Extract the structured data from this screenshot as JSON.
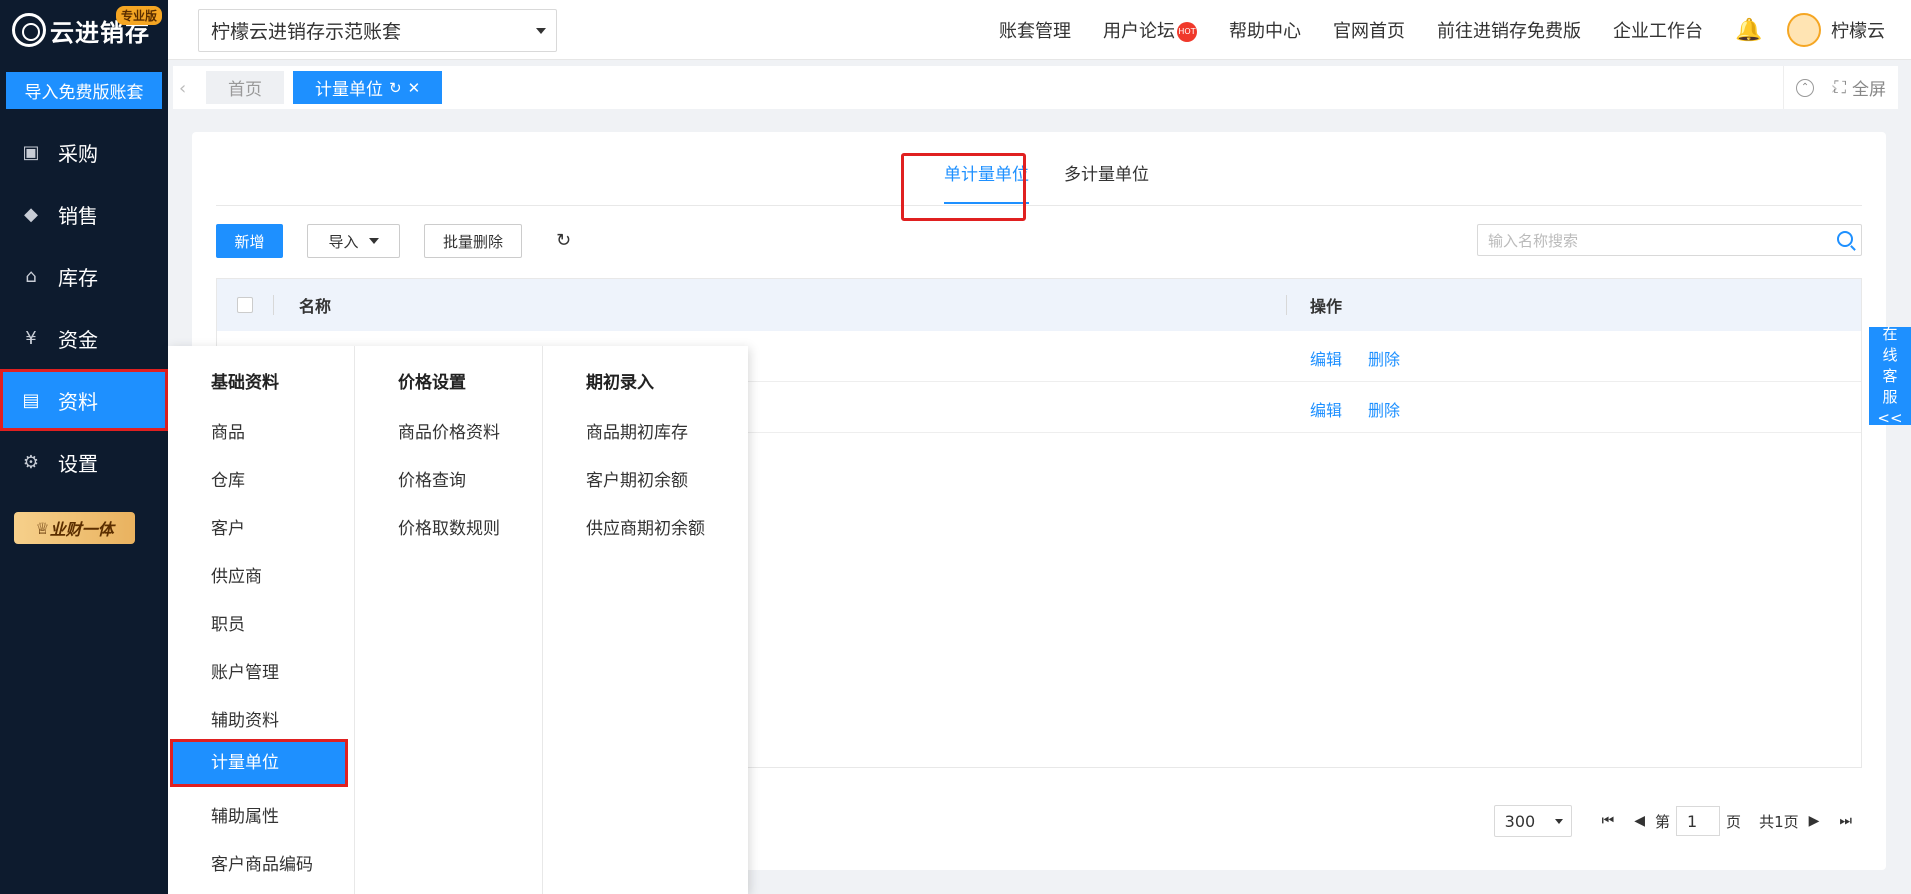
{
  "brand": {
    "name": "云进销存",
    "badge": "专业版"
  },
  "sidebar": {
    "import_label": "导入免费版账套",
    "items": [
      {
        "label": "采购",
        "icon": "bag-icon"
      },
      {
        "label": "销售",
        "icon": "tag-icon"
      },
      {
        "label": "库存",
        "icon": "warehouse-icon"
      },
      {
        "label": "资金",
        "icon": "yen-icon"
      },
      {
        "label": "资料",
        "icon": "document-icon"
      },
      {
        "label": "设置",
        "icon": "gear-icon"
      }
    ],
    "vip_label": "业财一体"
  },
  "header": {
    "account": "柠檬云进销存示范账套",
    "links": [
      "账套管理",
      "用户论坛",
      "帮助中心",
      "官网首页",
      "前往进销存免费版",
      "企业工作台"
    ],
    "hot_badge": "HOT",
    "user": "柠檬云"
  },
  "tabs": {
    "home": "首页",
    "current": "计量单位",
    "fullscreen": "全屏"
  },
  "main": {
    "subtabs": [
      "单计量单位",
      "多计量单位"
    ],
    "toolbar": {
      "add": "新增",
      "import": "导入",
      "batch_delete": "批量删除"
    },
    "search_placeholder": "输入名称搜索",
    "columns": {
      "name": "名称",
      "op": "操作"
    },
    "row_actions": {
      "edit": "编辑",
      "delete": "删除"
    },
    "pager": {
      "page_size": "300",
      "prefix": "第",
      "page": "1",
      "suffix": "页",
      "total": "共1页"
    }
  },
  "menu": {
    "basic": {
      "title": "基础资料",
      "items": [
        "商品",
        "仓库",
        "客户",
        "供应商",
        "职员",
        "账户管理",
        "辅助资料",
        "计量单位",
        "辅助属性",
        "客户商品编码"
      ]
    },
    "price": {
      "title": "价格设置",
      "items": [
        "商品价格资料",
        "价格查询",
        "价格取数规则"
      ]
    },
    "opening": {
      "title": "期初录入",
      "items": [
        "商品期初库存",
        "客户期初余额",
        "供应商期初余额"
      ]
    }
  },
  "service": {
    "chars": [
      "在",
      "线",
      "客",
      "服",
      "<<"
    ]
  }
}
